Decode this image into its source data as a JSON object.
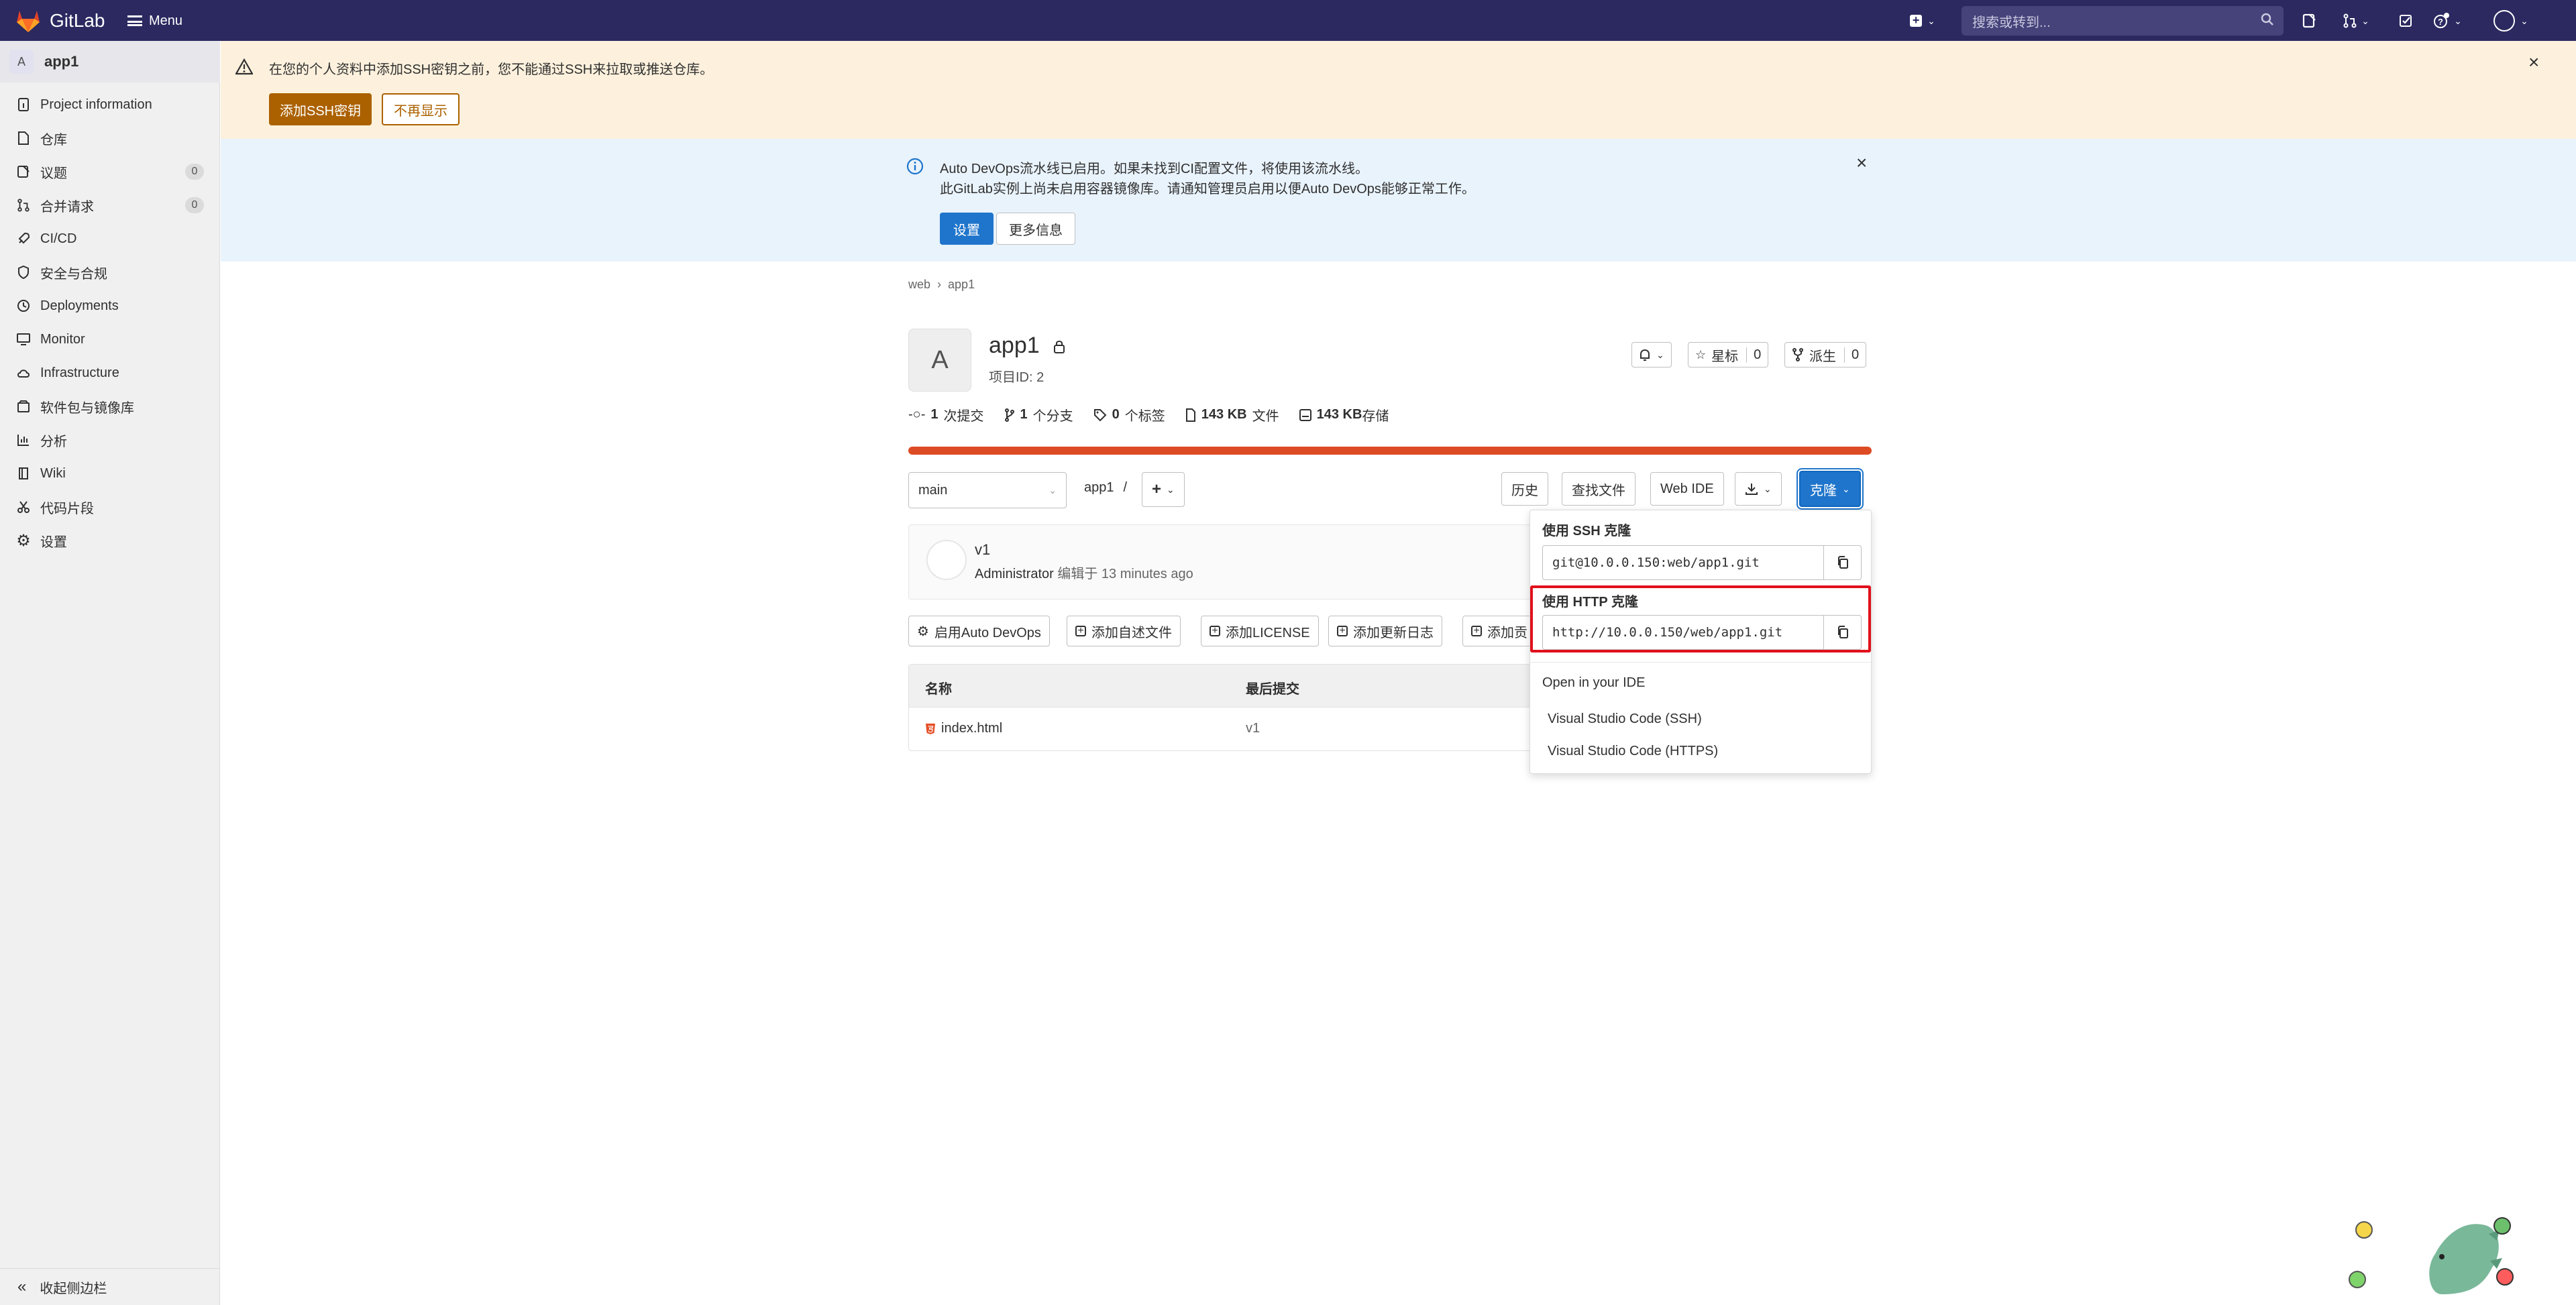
{
  "topbar": {
    "brand": "GitLab",
    "menu_label": "Menu",
    "search_placeholder": "搜索或转到..."
  },
  "sidebar": {
    "project_initial": "A",
    "project_name": "app1",
    "items": [
      {
        "label": "Project information",
        "icon": "info-doc-icon"
      },
      {
        "label": "仓库",
        "icon": "doc-icon"
      },
      {
        "label": "议题",
        "icon": "issues-icon",
        "badge": "0"
      },
      {
        "label": "合并请求",
        "icon": "merge-request-icon",
        "badge": "0"
      },
      {
        "label": "CI/CD",
        "icon": "rocket-icon"
      },
      {
        "label": "安全与合规",
        "icon": "shield-icon"
      },
      {
        "label": "Deployments",
        "icon": "deployments-icon"
      },
      {
        "label": "Monitor",
        "icon": "monitor-icon"
      },
      {
        "label": "Infrastructure",
        "icon": "cloud-icon"
      },
      {
        "label": "软件包与镜像库",
        "icon": "package-icon"
      },
      {
        "label": "分析",
        "icon": "chart-icon"
      },
      {
        "label": "Wiki",
        "icon": "book-icon"
      },
      {
        "label": "代码片段",
        "icon": "scissors-icon"
      },
      {
        "label": "设置",
        "icon": "gear-icon"
      }
    ],
    "collapse_label": "收起侧边栏"
  },
  "ssh_alert": {
    "text": "在您的个人资料中添加SSH密钥之前，您不能通过SSH来拉取或推送仓库。",
    "add_button": "添加SSH密钥",
    "dismiss_button": "不再显示"
  },
  "devops_alert": {
    "line1": "Auto DevOps流水线已启用。如果未找到CI配置文件，将使用该流水线。",
    "line2": "此GitLab实例上尚未启用容器镜像库。请通知管理员启用以便Auto DevOps能够正常工作。",
    "settings_button": "设置",
    "more_button": "更多信息"
  },
  "breadcrumb": [
    "web",
    "app1"
  ],
  "project": {
    "initial": "A",
    "name": "app1",
    "id_text": "项目ID: 2",
    "star_label": "星标",
    "star_count": "0",
    "fork_label": "派生",
    "fork_count": "0"
  },
  "stats": {
    "commits_num": "1",
    "commits_label": "次提交",
    "branches_num": "1",
    "branches_label": "个分支",
    "tags_num": "0",
    "tags_label": "个标签",
    "files_size": "143 KB",
    "files_label": "文件",
    "storage_size": "143 KB",
    "storage_label": "存储"
  },
  "repo_toolbar": {
    "branch": "main",
    "path": "app1",
    "path_sep": "/",
    "history": "历史",
    "find_file": "查找文件",
    "web_ide": "Web IDE",
    "clone": "克隆"
  },
  "commit": {
    "title": "v1",
    "author": "Administrator",
    "meta": "编辑于 13 minutes ago"
  },
  "quick_actions": [
    "启用Auto DevOps",
    "添加自述文件",
    "添加LICENSE",
    "添加更新日志",
    "添加贡"
  ],
  "file_table": {
    "col_name": "名称",
    "col_last_commit": "最后提交",
    "rows": [
      {
        "name": "index.html",
        "last_commit": "v1"
      }
    ]
  },
  "clone_dropdown": {
    "ssh_label": "使用 SSH 克隆",
    "ssh_url": "git@10.0.0.150:web/app1.git",
    "http_label": "使用 HTTP 克隆",
    "http_url": "http://10.0.0.150/web/app1.git",
    "ide_label": "Open in your IDE",
    "ide_options": [
      "Visual Studio Code (SSH)",
      "Visual Studio Code (HTTPS)"
    ]
  },
  "colors": {
    "topbar": "#2b2960",
    "primary": "#1f75cb",
    "warning": "#ab6100",
    "highlight": "#e0101b",
    "progress": "#dd4b25"
  }
}
